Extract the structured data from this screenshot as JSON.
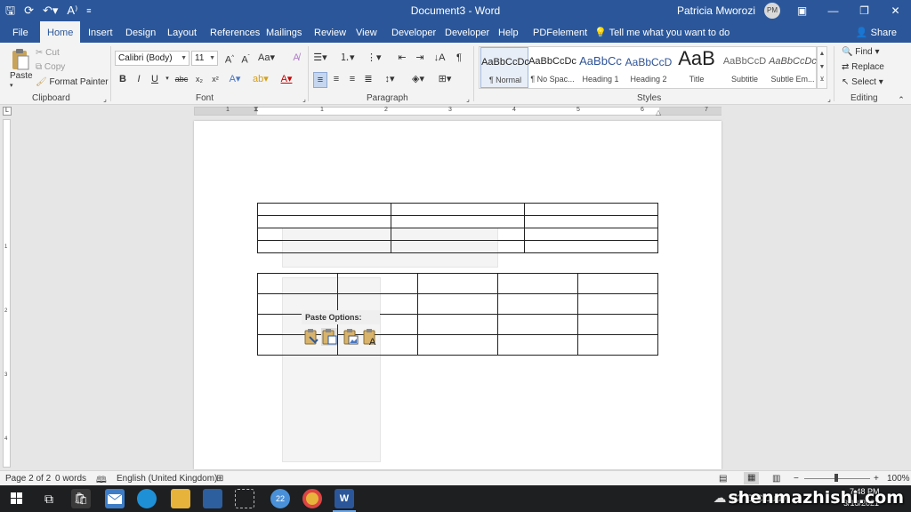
{
  "titlebar": {
    "title": "Document3 - Word",
    "user": "Patricia Mworozi",
    "avatar": "PM",
    "icons": [
      "save-icon",
      "autosave-icon",
      "undo-icon",
      "touch-mode-icon",
      "customize-icon"
    ]
  },
  "tabs": [
    "File",
    "Home",
    "Insert",
    "Design",
    "Layout",
    "References",
    "Mailings",
    "Review",
    "View",
    "Developer",
    "Developer",
    "Help",
    "PDFelement"
  ],
  "active_tab": "Home",
  "tell_me": "Tell me what you want to do",
  "share": "Share",
  "ribbon": {
    "clipboard": {
      "paste": "Paste",
      "cut": "Cut",
      "copy": "Copy",
      "format_painter": "Format Painter",
      "label": "Clipboard"
    },
    "font": {
      "name": "Calibri (Body)",
      "size": "11",
      "label": "Font"
    },
    "paragraph": {
      "label": "Paragraph"
    },
    "styles": {
      "label": "Styles",
      "items": [
        {
          "preview": "AaBbCcDc",
          "name": "¶ Normal"
        },
        {
          "preview": "AaBbCcDc",
          "name": "¶ No Spac..."
        },
        {
          "preview": "AaBbCc",
          "name": "Heading 1"
        },
        {
          "preview": "AaBbCcD",
          "name": "Heading 2"
        },
        {
          "preview": "AaB",
          "name": "Title"
        },
        {
          "preview": "AaBbCcD",
          "name": "Subtitle"
        },
        {
          "preview": "AaBbCcDc",
          "name": "Subtle Em..."
        }
      ]
    },
    "editing": {
      "find": "Find",
      "replace": "Replace",
      "select": "Select",
      "label": "Editing"
    }
  },
  "ruler": {
    "numbers": [
      "1",
      "1",
      "2",
      "3",
      "4",
      "5",
      "6",
      "7"
    ],
    "vnumbers": [
      "1",
      "2",
      "3",
      "4"
    ]
  },
  "paste_options": {
    "title": "Paste Options:"
  },
  "status": {
    "page": "Page 2 of 2",
    "words": "0 words",
    "language": "English (United Kingdom)",
    "zoom": "100%"
  },
  "taskbar": {
    "weather": "22°C  Cloudy",
    "badge": "22",
    "time": "7:48 PM",
    "date": "3/18/2021"
  },
  "watermark": "shenmazhishi.com",
  "colors": {
    "word_blue": "#2b579a",
    "ribbon_bg": "#f3f3f3",
    "taskbar": "#1d1f21"
  }
}
